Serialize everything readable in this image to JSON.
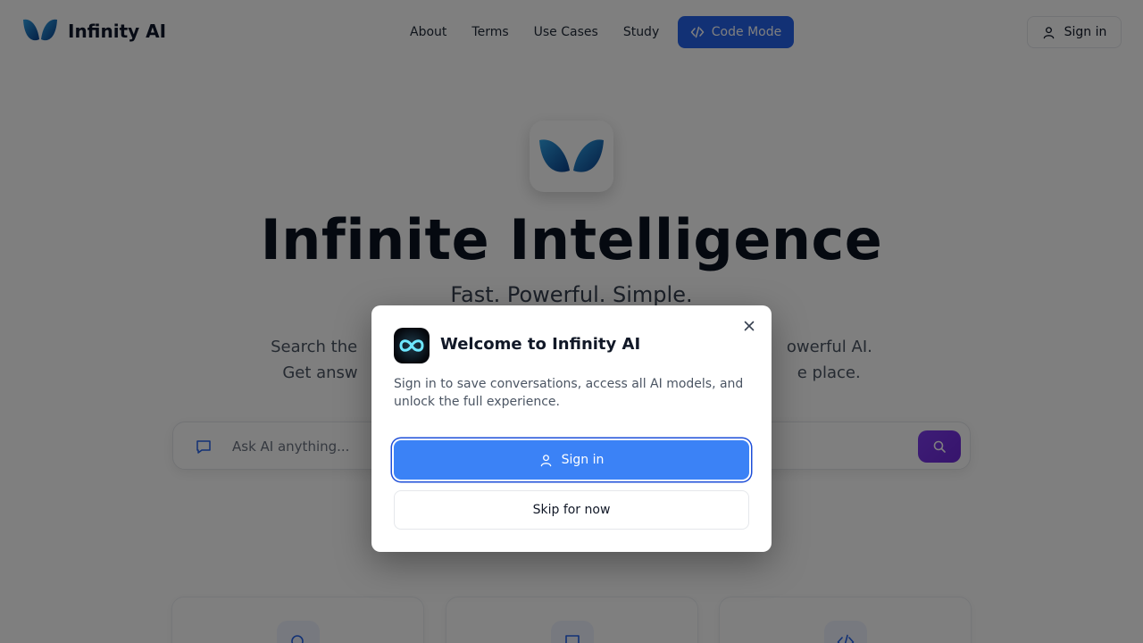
{
  "header": {
    "brand_name": "Infinity AI",
    "nav": [
      "About",
      "Terms",
      "Use Cases",
      "Study"
    ],
    "code_mode_label": "Code Mode",
    "sign_in_label": "Sign in"
  },
  "hero": {
    "title": "Infinite Intelligence",
    "subtitle": "Fast. Powerful. Simple.",
    "description_line1_visible": "Search the                                                                                    owerful AI.",
    "description_line2_visible": "Get answ                                                                                      e place."
  },
  "search": {
    "placeholder": "Ask AI anything..."
  },
  "modal": {
    "title": "Welcome to Infinity AI",
    "description": "Sign in to save conversations, access all AI models, and unlock the full experience.",
    "sign_in_label": "Sign in",
    "skip_label": "Skip for now"
  },
  "colors": {
    "primary": "#2563eb",
    "modal_button": "#3b82f6",
    "search_submit": "#7c3aed",
    "overlay": "rgba(0,0,0,0.5)"
  },
  "icons": {
    "brand": "butterfly-logo-icon",
    "code": "code-icon",
    "user": "user-icon",
    "chat": "chat-icon",
    "search": "search-icon",
    "close": "close-icon",
    "modal_logo": "infinity-icon"
  }
}
